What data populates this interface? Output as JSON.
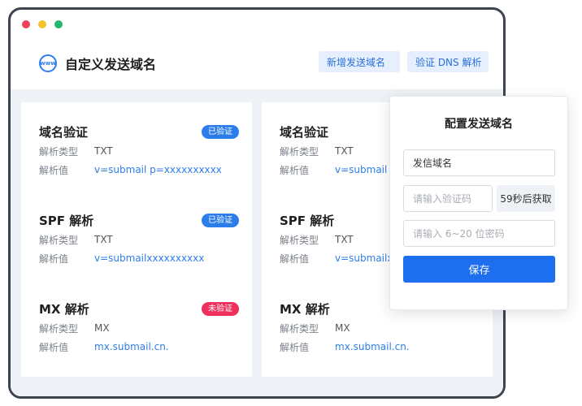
{
  "header": {
    "title": "自定义发送域名",
    "logo_text": "www",
    "add_domain_button": "新增发送域名",
    "verify_dns_button": "验证 DNS 解析"
  },
  "cards": [
    {
      "sections": [
        {
          "title": "域名验证",
          "badge": "已验证",
          "status": "verified",
          "type_label": "解析类型",
          "type_value": "TXT",
          "value_label": "解析值",
          "value": "v=submail p=xxxxxxxxxx"
        },
        {
          "title": "SPF 解析",
          "badge": "已验证",
          "status": "verified",
          "type_label": "解析类型",
          "type_value": "TXT",
          "value_label": "解析值",
          "value": "v=submailxxxxxxxxxx"
        },
        {
          "title": "MX 解析",
          "badge": "未验证",
          "status": "unverified",
          "type_label": "解析类型",
          "type_value": "MX",
          "value_label": "解析值",
          "value": "mx.submail.cn."
        }
      ]
    },
    {
      "sections": [
        {
          "title": "域名验证",
          "type_label": "解析类型",
          "type_value": "TXT",
          "value_label": "解析值",
          "value": "v=submail p"
        },
        {
          "title": "SPF 解析",
          "type_label": "解析类型",
          "type_value": "TXT",
          "value_label": "解析值",
          "value": "v=submailx"
        },
        {
          "title": "MX 解析",
          "type_label": "解析类型",
          "type_value": "MX",
          "value_label": "解析值",
          "value": "mx.submail.cn."
        }
      ]
    }
  ],
  "panel": {
    "title": "配置发送域名",
    "sender_domain_value": "发信域名",
    "code_placeholder": "请输入验证码",
    "countdown": "59秒后获取",
    "password_placeholder": "请输入 6~20 位密码",
    "save_button": "保存"
  },
  "colors": {
    "accent": "#1e6ef0",
    "verified_badge": "#2b7de9",
    "unverified_badge": "#f0305c",
    "window_border": "#3d4450",
    "content_bg": "#eef1f6"
  }
}
